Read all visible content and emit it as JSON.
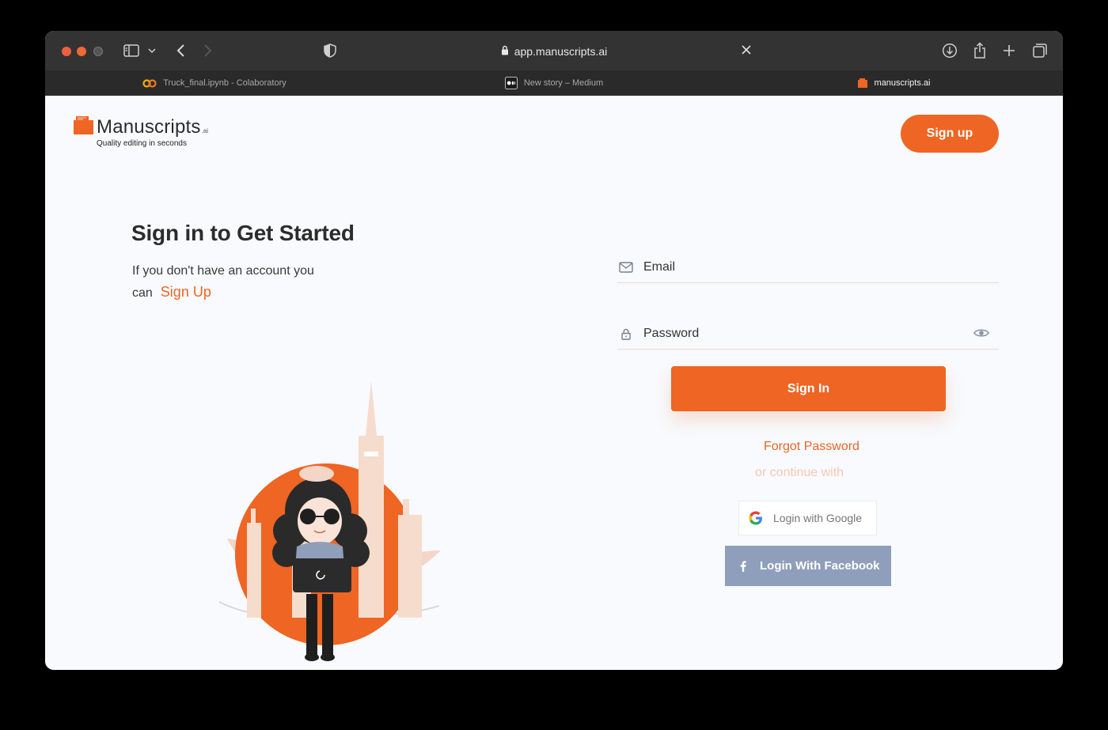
{
  "browser": {
    "url": "app.manuscripts.ai",
    "tabs": [
      {
        "title": "Truck_final.ipynb - Colaboratory",
        "favicon": "colab-icon",
        "active": false
      },
      {
        "title": "New story – Medium",
        "favicon": "medium-icon",
        "active": false
      },
      {
        "title": "manuscripts.ai",
        "favicon": "manuscripts-icon",
        "active": true
      }
    ]
  },
  "header": {
    "brand_name": "Manuscripts",
    "brand_suffix": ".ai",
    "tagline": "Quality editing in seconds",
    "signup_label": "Sign up"
  },
  "intro": {
    "title": "Sign in to Get Started",
    "line1": "If you don't have an account you",
    "line2": "can",
    "signup_link": "Sign Up"
  },
  "form": {
    "email_label": "Email",
    "password_label": "Password",
    "signin_label": "Sign In",
    "forgot_label": "Forgot Password",
    "continue_label": "or continue with",
    "google_label": "Login with Google",
    "facebook_label": "Login With Facebook"
  },
  "colors": {
    "accent": "#ee6524",
    "facebook_button": "#8f9ebb",
    "chrome_dark": "#333334"
  }
}
